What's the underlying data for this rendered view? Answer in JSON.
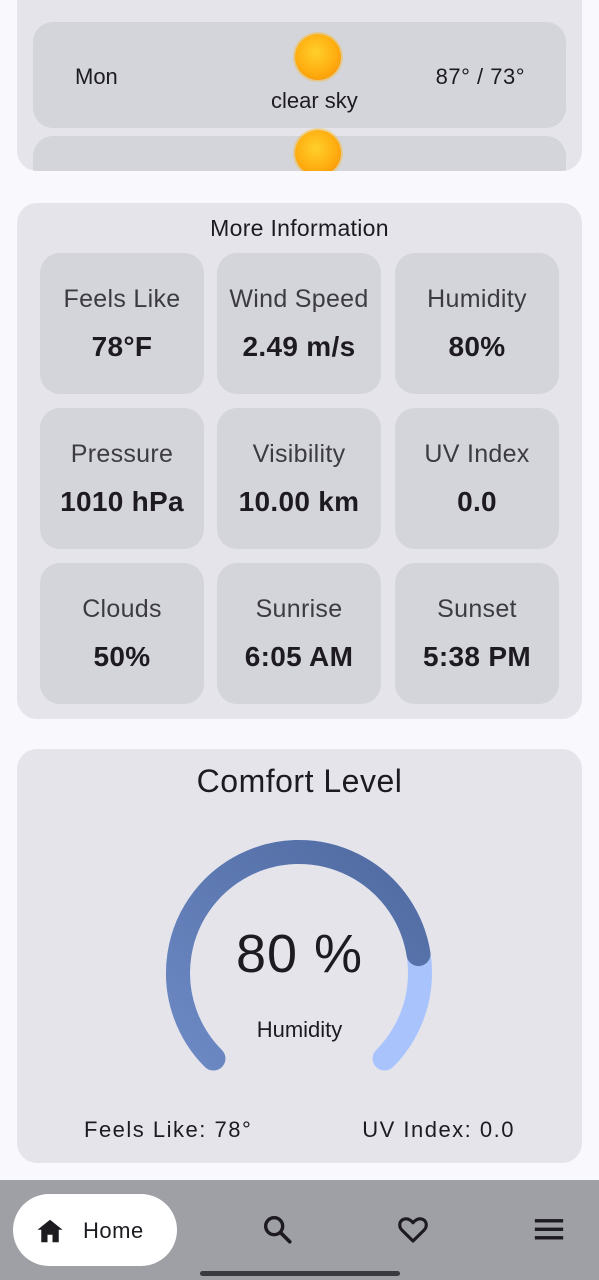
{
  "forecast": {
    "rows": [
      {
        "day": "Mon",
        "description": "clear sky",
        "temps": "87° / 73°",
        "icon": "sun-icon"
      }
    ]
  },
  "more_info": {
    "title": "More Information",
    "tiles": [
      {
        "label": "Feels Like",
        "value": "78°F"
      },
      {
        "label": "Wind Speed",
        "value": "2.49 m/s"
      },
      {
        "label": "Humidity",
        "value": "80%"
      },
      {
        "label": "Pressure",
        "value": "1010 hPa"
      },
      {
        "label": "Visibility",
        "value": "10.00 km"
      },
      {
        "label": "UV Index",
        "value": "0.0"
      },
      {
        "label": "Clouds",
        "value": "50%"
      },
      {
        "label": "Sunrise",
        "value": "6:05 AM"
      },
      {
        "label": "Sunset",
        "value": "5:38 PM"
      }
    ]
  },
  "comfort": {
    "title": "Comfort Level",
    "value_text": "80 %",
    "value_fraction": 0.8,
    "label": "Humidity",
    "feels_like": "Feels Like: 78°",
    "uv_index": "UV Index: 0.0",
    "colors": {
      "track": "#a9c4fc",
      "progress_start": "#6d89c4",
      "progress_end": "#4f6aa0"
    }
  },
  "nav": {
    "home_label": "Home",
    "items": [
      "home-icon",
      "search-icon",
      "heart-icon",
      "menu-icon"
    ]
  }
}
